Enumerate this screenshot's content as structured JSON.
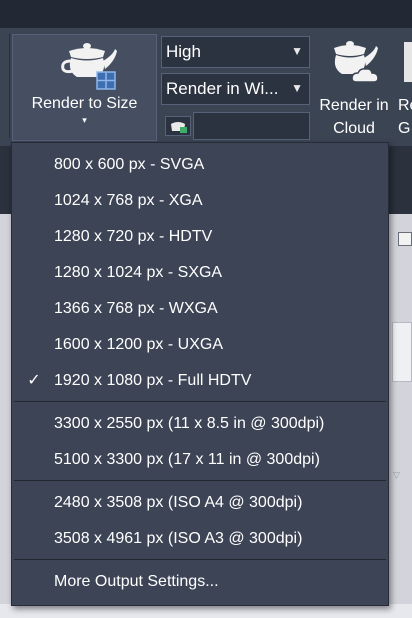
{
  "ribbon": {
    "render_to_size": {
      "label": "Render to Size",
      "caret": "▾"
    },
    "quality_dropdown": {
      "value": "High",
      "arrow": "▼"
    },
    "target_dropdown": {
      "value": "Render in Wi...",
      "arrow": "▼"
    },
    "render_in_cloud": {
      "line1": "Render in",
      "line2": "Cloud"
    },
    "gallery": {
      "line1": "Re",
      "line2": "G"
    }
  },
  "menu": {
    "items": [
      {
        "label": "800 x 600 px - SVGA",
        "checked": false
      },
      {
        "label": "1024 x 768 px - XGA",
        "checked": false
      },
      {
        "label": "1280 x 720 px - HDTV",
        "checked": false
      },
      {
        "label": "1280 x 1024 px - SXGA",
        "checked": false
      },
      {
        "label": "1366 x 768 px - WXGA",
        "checked": false
      },
      {
        "label": "1600 x 1200 px - UXGA",
        "checked": false
      },
      {
        "label": "1920 x 1080 px - Full HDTV",
        "checked": true
      },
      {
        "label": "3300 x 2550 px (11 x 8.5 in @ 300dpi)",
        "checked": false
      },
      {
        "label": "5100 x 3300 px (17 x 11 in @ 300dpi)",
        "checked": false
      },
      {
        "label": "2480 x 3508 px (ISO A4 @ 300dpi)",
        "checked": false
      },
      {
        "label": "3508 x 4961 px (ISO A3 @ 300dpi)",
        "checked": false
      },
      {
        "label": "More Output Settings...",
        "checked": false
      }
    ],
    "check_glyph": "✓"
  },
  "viewport": {
    "scroll_arrow": "▽"
  }
}
